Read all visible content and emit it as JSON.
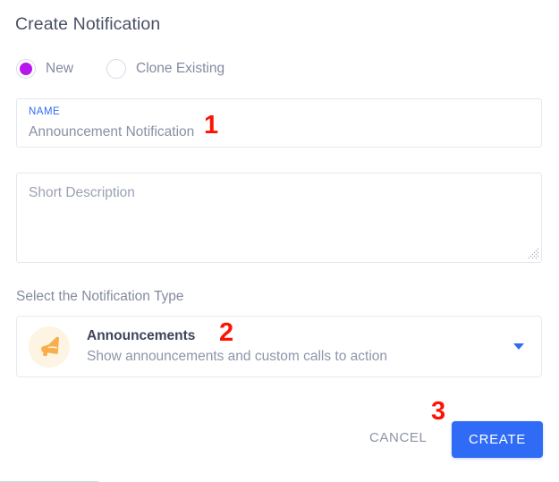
{
  "dialog": {
    "title": "Create Notification"
  },
  "mode_options": [
    {
      "label": "New",
      "selected": true,
      "icon": "radio-filled-icon"
    },
    {
      "label": "Clone Existing",
      "selected": false,
      "icon": "radio-empty-icon"
    }
  ],
  "name_field": {
    "label": "NAME",
    "value": "Announcement Notification"
  },
  "description_field": {
    "placeholder": "Short Description",
    "value": "",
    "resize_handle_icon": "resize-grip-icon"
  },
  "type_section": {
    "label": "Select the Notification Type",
    "selected": {
      "icon": "megaphone-icon",
      "title": "Announcements",
      "description": "Show announcements and custom calls to action"
    },
    "caret_icon": "chevron-down-icon"
  },
  "footer": {
    "cancel_label": "CANCEL",
    "create_label": "CREATE"
  },
  "annotations": [
    {
      "id": "marker-1",
      "text": "1"
    },
    {
      "id": "marker-2",
      "text": "2"
    },
    {
      "id": "marker-3",
      "text": "3"
    }
  ],
  "colors": {
    "accent_blue": "#2f6bf5",
    "radio_purple": "#b716ef",
    "icon_orange": "#f9ad4b",
    "icon_bg": "#fdf4e3",
    "title_text": "#4a5066",
    "muted_text": "#848aa0",
    "border": "#e2e8f0",
    "annotation_red": "#fb1405"
  }
}
